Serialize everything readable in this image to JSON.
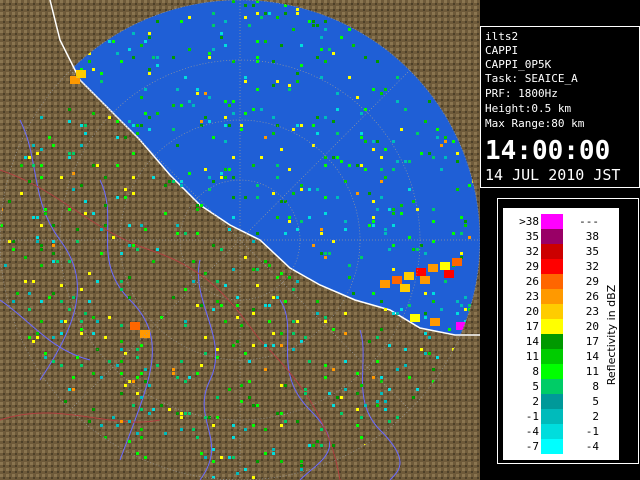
{
  "info_panel": {
    "lines": [
      "ilts2",
      "CAPPI",
      "CAPPI_0P5K",
      "Task: SEAICE_A",
      "PRF: 1800Hz",
      "Height:0.5 km",
      "Max Range:80 km"
    ],
    "time": "14:00:00",
    "date": "14 JUL 2010 JST"
  },
  "legend": {
    "title": "Reflectivity in dBZ",
    "rows": [
      {
        "low": ">38",
        "high": "---",
        "color": "#ff00ff"
      },
      {
        "low": "35",
        "high": "38",
        "color": "#990066"
      },
      {
        "low": "32",
        "high": "35",
        "color": "#cc0000"
      },
      {
        "low": "29",
        "high": "32",
        "color": "#ff0000"
      },
      {
        "low": "26",
        "high": "29",
        "color": "#ff6600"
      },
      {
        "low": "23",
        "high": "26",
        "color": "#ff9900"
      },
      {
        "low": "20",
        "high": "23",
        "color": "#ffcc00"
      },
      {
        "low": "17",
        "high": "20",
        "color": "#ffff00"
      },
      {
        "low": "14",
        "high": "17",
        "color": "#009900"
      },
      {
        "low": "11",
        "high": "14",
        "color": "#00cc00"
      },
      {
        "low": "8",
        "high": "11",
        "color": "#00ff00"
      },
      {
        "low": "5",
        "high": "8",
        "color": "#00cc66"
      },
      {
        "low": "2",
        "high": "5",
        "color": "#009999"
      },
      {
        "low": "-1",
        "high": "2",
        "color": "#00bbbb"
      },
      {
        "low": "-4",
        "high": "-1",
        "color": "#00dddd"
      },
      {
        "low": "-7",
        "high": "-4",
        "color": "#00ffff"
      }
    ]
  },
  "colors": {
    "sea": "#1f5fd6",
    "land": "#6e5a3a",
    "range_ring": "#888888",
    "rivers": "#6a6aff",
    "borders": "#b04040"
  }
}
